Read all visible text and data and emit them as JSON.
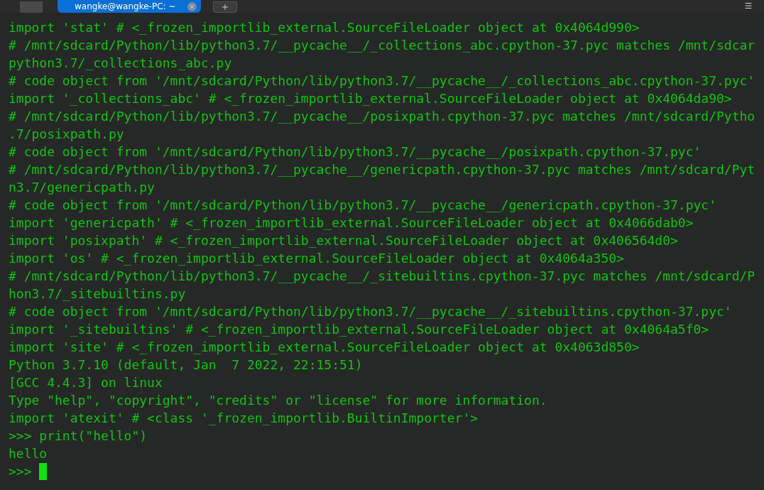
{
  "tabs": [
    {
      "label": "wangke@wangke-PC: ~",
      "selected": true
    }
  ],
  "terminal": {
    "lines": [
      "import 'stat' # <_frozen_importlib_external.SourceFileLoader object at 0x4064d990>",
      "# /mnt/sdcard/Python/lib/python3.7/__pycache__/_collections_abc.cpython-37.pyc matches /mnt/sdcar",
      "python3.7/_collections_abc.py",
      "# code object from '/mnt/sdcard/Python/lib/python3.7/__pycache__/_collections_abc.cpython-37.pyc'",
      "import '_collections_abc' # <_frozen_importlib_external.SourceFileLoader object at 0x4064da90>",
      "# /mnt/sdcard/Python/lib/python3.7/__pycache__/posixpath.cpython-37.pyc matches /mnt/sdcard/Pytho",
      ".7/posixpath.py",
      "# code object from '/mnt/sdcard/Python/lib/python3.7/__pycache__/posixpath.cpython-37.pyc'",
      "# /mnt/sdcard/Python/lib/python3.7/__pycache__/genericpath.cpython-37.pyc matches /mnt/sdcard/Pyt",
      "n3.7/genericpath.py",
      "# code object from '/mnt/sdcard/Python/lib/python3.7/__pycache__/genericpath.cpython-37.pyc'",
      "import 'genericpath' # <_frozen_importlib_external.SourceFileLoader object at 0x4066dab0>",
      "import 'posixpath' # <_frozen_importlib_external.SourceFileLoader object at 0x406564d0>",
      "import 'os' # <_frozen_importlib_external.SourceFileLoader object at 0x4064a350>",
      "# /mnt/sdcard/Python/lib/python3.7/__pycache__/_sitebuiltins.cpython-37.pyc matches /mnt/sdcard/P",
      "hon3.7/_sitebuiltins.py",
      "# code object from '/mnt/sdcard/Python/lib/python3.7/__pycache__/_sitebuiltins.cpython-37.pyc'",
      "import '_sitebuiltins' # <_frozen_importlib_external.SourceFileLoader object at 0x4064a5f0>",
      "import 'site' # <_frozen_importlib_external.SourceFileLoader object at 0x4063d850>",
      "Python 3.7.10 (default, Jan  7 2022, 22:15:51)",
      "[GCC 4.4.3] on linux",
      "Type \"help\", \"copyright\", \"credits\" or \"license\" for more information.",
      "import 'atexit' # <class '_frozen_importlib.BuiltinImporter'>",
      ">>> print(\"hello\")",
      "hello"
    ],
    "prompt": ">>>"
  }
}
